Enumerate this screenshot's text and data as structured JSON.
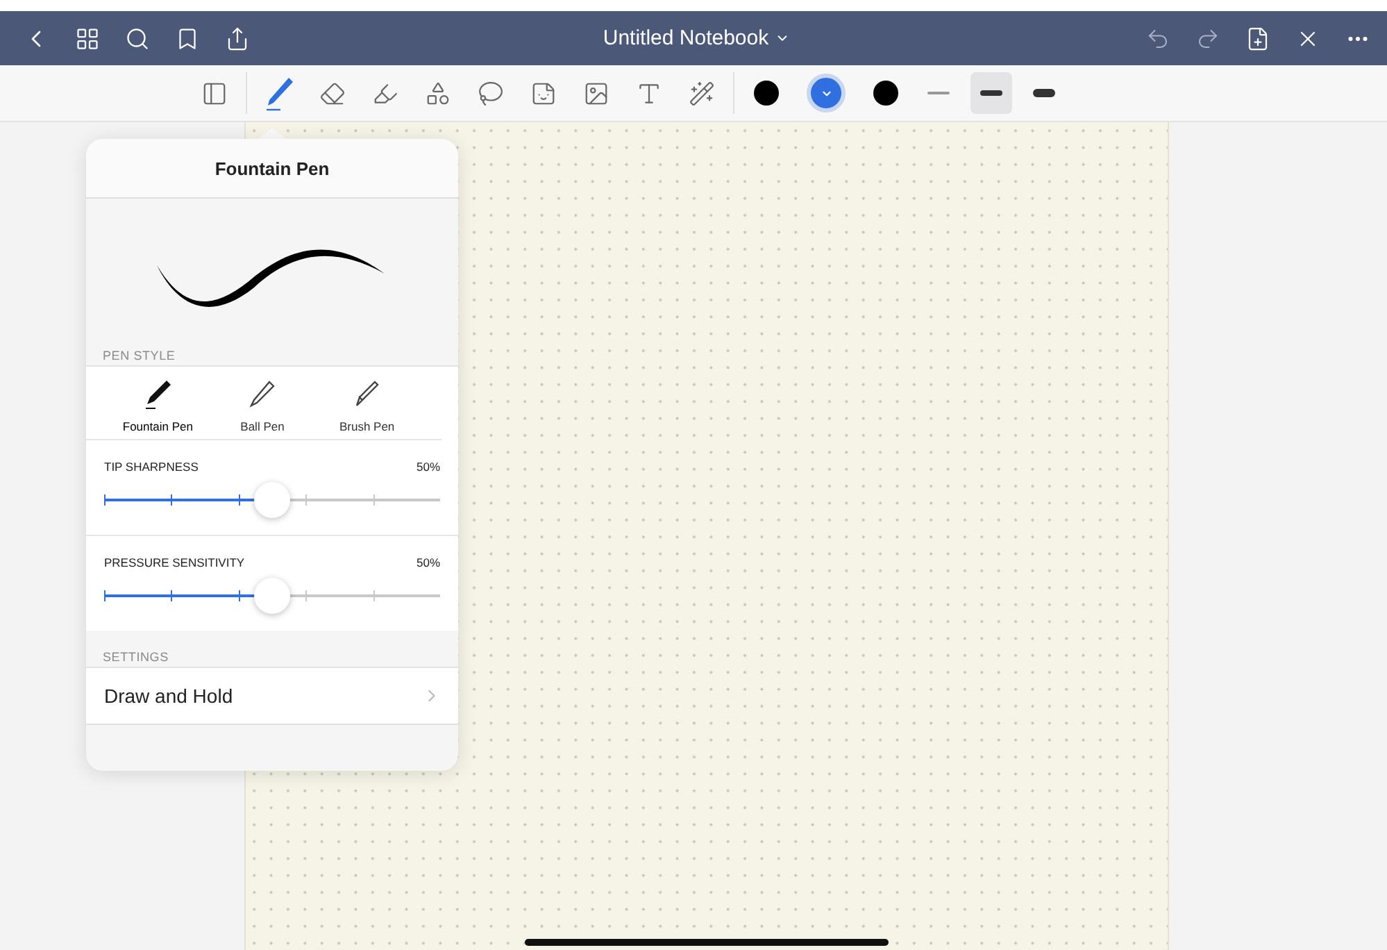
{
  "title_bar": {
    "title": "Untitled Notebook"
  },
  "tools": [
    {
      "kind": "layout",
      "selected": false
    },
    {
      "kind": "pen",
      "selected": true
    },
    {
      "kind": "eraser",
      "selected": false
    },
    {
      "kind": "highlighter",
      "selected": false
    },
    {
      "kind": "shapes",
      "selected": false
    },
    {
      "kind": "lasso",
      "selected": false
    },
    {
      "kind": "sticker",
      "selected": false
    },
    {
      "kind": "image",
      "selected": false
    },
    {
      "kind": "text",
      "selected": false
    },
    {
      "kind": "laser",
      "selected": false
    }
  ],
  "colors": [
    {
      "color": "#000000",
      "selected": false
    },
    {
      "color": "#2f6fe0",
      "selected": true
    },
    {
      "color": "#000000",
      "selected": false
    }
  ],
  "widths": [
    {
      "kind": "thin",
      "selected": false
    },
    {
      "kind": "medium",
      "selected": true
    },
    {
      "kind": "thick",
      "selected": false
    }
  ],
  "popover": {
    "title": "Fountain Pen",
    "pen_style_label": "PEN STYLE",
    "styles": [
      {
        "kind": "fountain",
        "label": "Fountain Pen",
        "selected": true
      },
      {
        "kind": "ball",
        "label": "Ball Pen",
        "selected": false
      },
      {
        "kind": "brush",
        "label": "Brush Pen",
        "selected": false
      }
    ],
    "sliders": [
      {
        "label": "TIP SHARPNESS",
        "reading": "50%",
        "level": 0.5
      },
      {
        "label": "PRESSURE SENSITIVITY",
        "reading": "50%",
        "level": 0.5
      }
    ],
    "settings_label": "SETTINGS",
    "settings": [
      {
        "label": "Draw and Hold"
      }
    ]
  }
}
